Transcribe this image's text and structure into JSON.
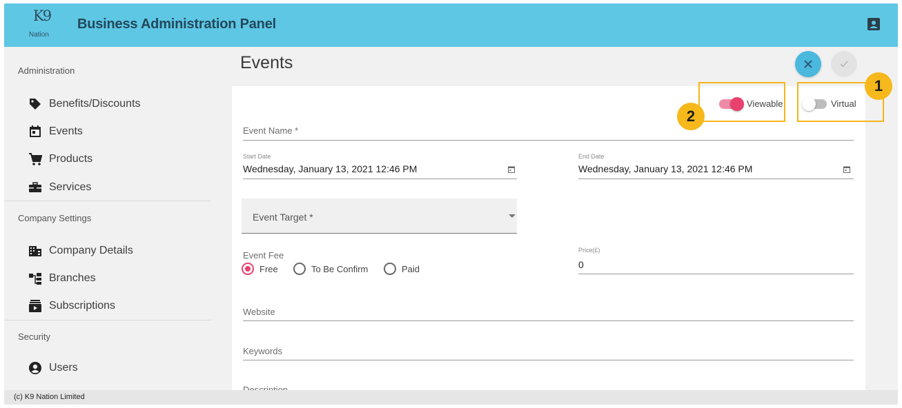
{
  "header": {
    "logo_mark": "K9",
    "logo_text": "Nation",
    "title": "Business Administration Panel"
  },
  "sidebar": {
    "sections": [
      {
        "title": "Administration"
      },
      {
        "title": "Company Settings"
      },
      {
        "title": "Security"
      }
    ],
    "items": [
      {
        "label": "Benefits/Discounts",
        "icon": "tag-icon"
      },
      {
        "label": "Events",
        "icon": "calendar-icon"
      },
      {
        "label": "Products",
        "icon": "cart-icon"
      },
      {
        "label": "Services",
        "icon": "toolbox-icon"
      },
      {
        "label": "Company Details",
        "icon": "building-icon"
      },
      {
        "label": "Branches",
        "icon": "branches-icon"
      },
      {
        "label": "Subscriptions",
        "icon": "subscriptions-icon"
      },
      {
        "label": "Users",
        "icon": "user-circle-icon"
      }
    ]
  },
  "page": {
    "title": "Events"
  },
  "toggles": {
    "viewable": {
      "label": "Viewable",
      "on": true
    },
    "virtual": {
      "label": "Virtual",
      "on": false
    }
  },
  "form": {
    "event_name_label": "Event Name *",
    "start_date_label": "Start Date",
    "start_date_value": "Wednesday, January 13, 2021 12:46 PM",
    "end_date_label": "End Date",
    "end_date_value": "Wednesday, January 13, 2021 12:46 PM",
    "event_target_label": "Event Target *",
    "event_fee_label": "Event Fee",
    "fee_options": [
      "Free",
      "To Be Confirm",
      "Paid"
    ],
    "fee_selected": "Free",
    "price_label": "Price(£)",
    "price_value": "0",
    "website_label": "Website",
    "keywords_label": "Keywords",
    "description_label": "Description"
  },
  "annotations": {
    "badge_1": "1",
    "badge_2": "2"
  },
  "footer": {
    "text": "(c) K9 Nation Limited"
  },
  "colors": {
    "header_bg": "#5ec7e4",
    "accent_pink": "#e8416e",
    "cancel_button": "#4bb8dd",
    "annotation": "#f5b51a"
  }
}
